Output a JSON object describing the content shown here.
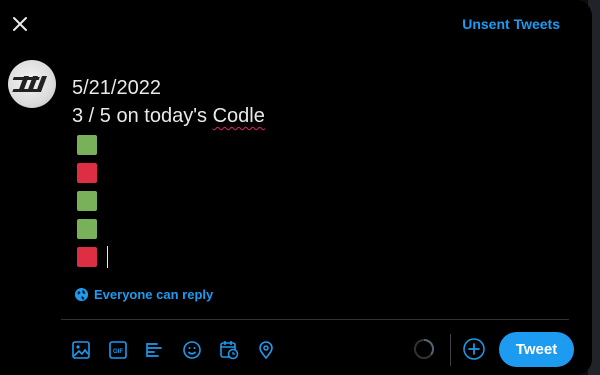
{
  "header": {
    "close_icon": "close-icon",
    "unsent_label": "Unsent Tweets"
  },
  "compose": {
    "line1": "5/21/2022",
    "line2_prefix": "3 / 5 on today's ",
    "line2_word": "Codle",
    "result_grid": [
      "green",
      "red",
      "green",
      "green",
      "red"
    ]
  },
  "reply_setting": {
    "icon": "globe-icon",
    "label": "Everyone can reply"
  },
  "toolbar": {
    "icons": [
      "image-icon",
      "gif-icon",
      "poll-icon",
      "emoji-icon",
      "schedule-icon",
      "location-icon"
    ]
  },
  "actions": {
    "tweet_label": "Tweet",
    "add_icon": "plus-icon",
    "progress_icon": "character-counter-icon"
  },
  "colors": {
    "accent": "#1d9bf0",
    "green_square": "#78b159",
    "red_square": "#dd2e44"
  }
}
